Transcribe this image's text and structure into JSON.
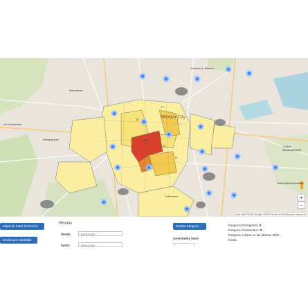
{
  "map": {
    "city_label": "Mexico City",
    "place_labels": [
      {
        "name": "Naucalpan",
        "cls": "place-naucalpan"
      },
      {
        "name": "Huixquilucan",
        "cls": "place-huixquilucan"
      },
      {
        "name": "Los Camposas",
        "cls": "place-loscamposas"
      },
      {
        "name": "Ciudad Nezahualcóyotl",
        "cls": "place-neza"
      },
      {
        "name": "Santa Martha Acatitla",
        "cls": "place-santamartha"
      },
      {
        "name": "Culhuacan",
        "cls": "place-culhuacan"
      },
      {
        "name": "Gustavo A. Madero",
        "cls": "place-gam"
      }
    ],
    "zoom_in": "+",
    "zoom_out": "−",
    "attribution": "Map data ©2016 Google, INEGI   Terms of Use   Report a map error",
    "region_colors": {
      "light": "#fbeea0",
      "mid": "#f4c94f",
      "high": "#e7862e",
      "max": "#d9402b"
    }
  },
  "controls": {
    "heatmap_button": "Mapa de Calor de Envíos",
    "quantity_button": "Envíos por Cantidad",
    "envios_title": "Envíos",
    "desde_label": "desde:",
    "desde_value": "01/01/2015",
    "hasta_label": "hasta:",
    "hasta_value": "02/01/2016",
    "hide_kangous_button": "Ocultar Kangous",
    "conectados_label": "conectados hace:"
  },
  "stats": {
    "entregando_label": "Kangous Entregando:",
    "entregando_value": "6",
    "conectados_label": "Kangous Conectados:",
    "conectados_value": "0",
    "activos_label": "Kangous Activos en las últimas 4800",
    "activos_suffix": "horas:"
  },
  "accent": "#2a6ebc",
  "marker_color": "#3d7bea"
}
